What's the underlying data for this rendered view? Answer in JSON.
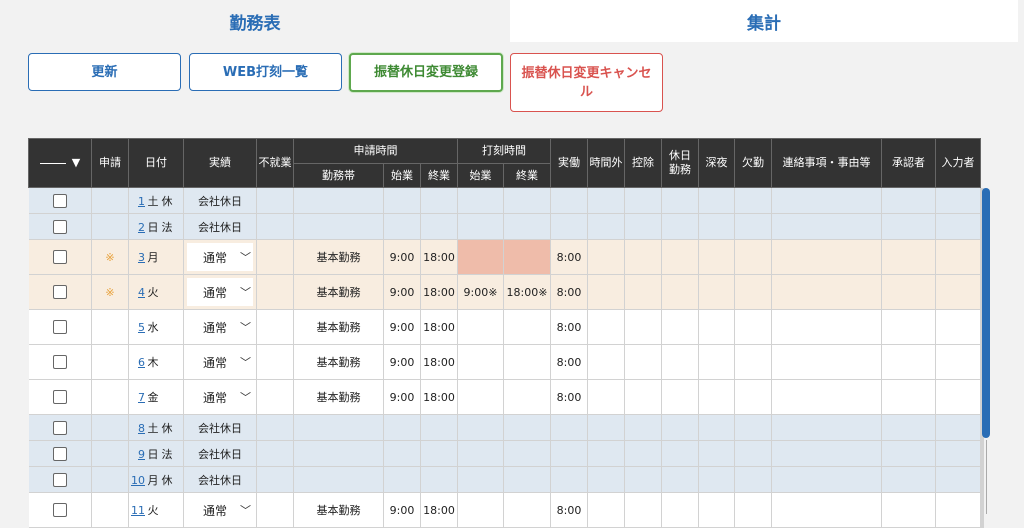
{
  "tabs": [
    {
      "label": "勤務表"
    },
    {
      "label": "集計"
    }
  ],
  "buttons": {
    "update": "更新",
    "web_punch_list": "WEB打刻一覧",
    "register_substitute": "振替休日変更登録",
    "cancel_substitute_line1": "振替休日変更キャンセ",
    "cancel_substitute_line2": "ル"
  },
  "table": {
    "headers": {
      "filter_icon": "▼",
      "apply": "申請",
      "date": "日付",
      "result": "実績",
      "absent": "不就業",
      "request_time": "申請時間",
      "work_band": "勤務帯",
      "start": "始業",
      "end": "終業",
      "punch_time": "打刻時間",
      "punch_start": "始業",
      "punch_end": "終業",
      "actual": "実働",
      "overtime": "時間外",
      "deduction": "控除",
      "holiday_work": "休日勤務",
      "late_night": "深夜",
      "absence": "欠勤",
      "remarks": "連絡事項・事由等",
      "approver": "承認者",
      "inputter": "入力者"
    },
    "rows": [
      {
        "type": "holiday",
        "day": "1",
        "dow": "土",
        "hol": "休",
        "result": "会社休日"
      },
      {
        "type": "holiday",
        "day": "2",
        "dow": "日",
        "hol": "法",
        "result": "会社休日"
      },
      {
        "type": "applied",
        "mark": "※",
        "day": "3",
        "dow": "月",
        "hol": "",
        "select": "通常",
        "band": "基本勤務",
        "start": "9:00",
        "end": "18:00",
        "pstart": "",
        "pend": "",
        "actual": "8:00",
        "pink": true
      },
      {
        "type": "applied",
        "mark": "※",
        "day": "4",
        "dow": "火",
        "hol": "",
        "select": "通常",
        "band": "基本勤務",
        "start": "9:00",
        "end": "18:00",
        "pstart": "9:00※",
        "pend": "18:00※",
        "actual": "8:00"
      },
      {
        "type": "normal",
        "day": "5",
        "dow": "水",
        "hol": "",
        "select": "通常",
        "band": "基本勤務",
        "start": "9:00",
        "end": "18:00",
        "actual": "8:00"
      },
      {
        "type": "normal",
        "day": "6",
        "dow": "木",
        "hol": "",
        "select": "通常",
        "band": "基本勤務",
        "start": "9:00",
        "end": "18:00",
        "actual": "8:00"
      },
      {
        "type": "normal",
        "day": "7",
        "dow": "金",
        "hol": "",
        "select": "通常",
        "band": "基本勤務",
        "start": "9:00",
        "end": "18:00",
        "actual": "8:00"
      },
      {
        "type": "holiday",
        "day": "8",
        "dow": "土",
        "hol": "休",
        "result": "会社休日"
      },
      {
        "type": "holiday",
        "day": "9",
        "dow": "日",
        "hol": "法",
        "result": "会社休日"
      },
      {
        "type": "holiday",
        "day": "10",
        "dow": "月",
        "hol": "休",
        "result": "会社休日"
      },
      {
        "type": "normal",
        "day": "11",
        "dow": "火",
        "hol": "",
        "select": "通常",
        "band": "基本勤務",
        "start": "9:00",
        "end": "18:00",
        "actual": "8:00"
      }
    ]
  },
  "colors": {
    "accent": "#2a6db5",
    "holiday_row": "#dfe8f1",
    "applied_row": "#f8ede0",
    "pink_cell": "#efbcaa",
    "green_button": "#5ea84e",
    "red_button": "#d9534f"
  }
}
